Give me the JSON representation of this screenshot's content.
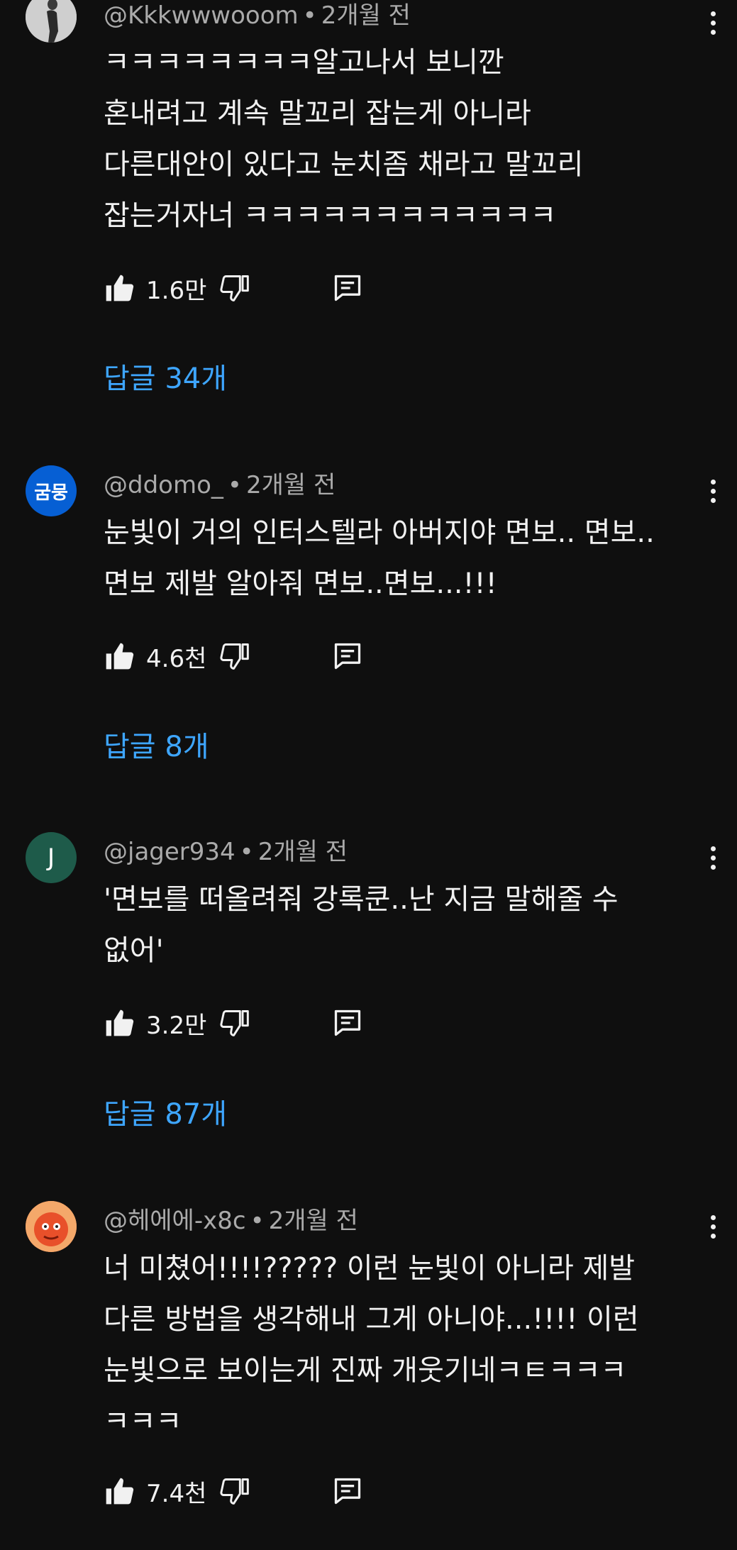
{
  "colors": {
    "background": "#0f0f0f",
    "text": "#f1f1f1",
    "meta": "#aaaaaa",
    "replies_link": "#3ea6ff"
  },
  "comments": [
    {
      "handle": "@Kkkwwwooom",
      "time": "2개월 전",
      "avatar_text": "",
      "avatar_color": "#d8d8d8",
      "text": "ㅋㅋㅋㅋㅋㅋㅋㅋ알고나서 보니깐\n혼내려고 계속 말꼬리 잡는게 아니라\n다른대안이 있다고 눈치좀 채라고 말꼬리\n잡는거자너 ㅋㅋㅋㅋㅋㅋㅋㅋㅋㅋㅋㅋ",
      "likes": "1.6만",
      "replies": "답글 34개"
    },
    {
      "handle": "@ddomo_",
      "time": "2개월 전",
      "avatar_text": "굼뭉",
      "avatar_color": "#065fd4",
      "text": "눈빛이 거의 인터스텔라 아버지야 면보.. 면보..\n면보 제발 알아줘 면보..면보...!!!",
      "likes": "4.6천",
      "replies": "답글 8개"
    },
    {
      "handle": "@jager934",
      "time": "2개월 전",
      "avatar_text": "J",
      "avatar_color": "#1e5b4a",
      "text": "'면보를 떠올려줘 강록쿤..난 지금 말해줄 수\n없어'",
      "likes": "3.2만",
      "replies": "답글 87개"
    },
    {
      "handle": "@헤에에-x8c",
      "time": "2개월 전",
      "avatar_text": "",
      "avatar_color": "#e8663a",
      "text": "너 미쳤어!!!!????? 이런 눈빛이 아니라 제발\n다른 방법을 생각해내 그게 아니야...!!!! 이런\n눈빛으로 보이는게 진짜 개웃기네ㅋㅌㅋㅋㅋ\nㅋㅋㅋ",
      "likes": "7.4천",
      "replies": ""
    }
  ],
  "icons": {
    "like": "thumb-up-icon",
    "dislike": "thumb-down-icon",
    "reply": "comment-reply-icon",
    "more": "more-vert-icon"
  }
}
